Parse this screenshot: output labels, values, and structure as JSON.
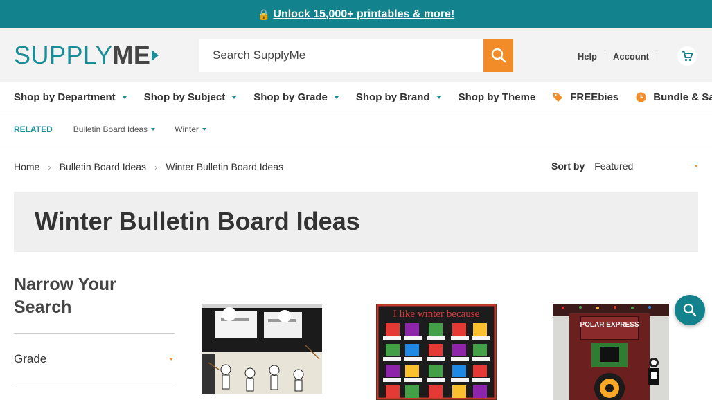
{
  "promo": {
    "text": "Unlock 15,000+ printables & more!"
  },
  "logo": {
    "part1": "SUPPLY",
    "part2": "ME"
  },
  "search": {
    "placeholder": "Search SupplyMe"
  },
  "header_links": {
    "help": "Help",
    "account": "Account"
  },
  "nav": {
    "items": [
      {
        "label": "Shop by Department"
      },
      {
        "label": "Shop by Subject"
      },
      {
        "label": "Shop by Grade"
      },
      {
        "label": "Shop by Brand"
      },
      {
        "label": "Shop by Theme"
      },
      {
        "label": "FREEbies"
      },
      {
        "label": "Bundle & Save!"
      }
    ]
  },
  "related": {
    "label": "RELATED",
    "items": [
      {
        "label": "Bulletin Board Ideas"
      },
      {
        "label": "Winter"
      }
    ]
  },
  "breadcrumb": {
    "items": [
      "Home",
      "Bulletin Board Ideas",
      "Winter Bulletin Board Ideas"
    ]
  },
  "sort": {
    "label": "Sort by",
    "value": "Featured"
  },
  "page": {
    "title": "Winter Bulletin Board Ideas"
  },
  "filters": {
    "title": "Narrow Your Search",
    "facets": [
      {
        "label": "Grade"
      }
    ]
  },
  "products": [
    {
      "image_text": ""
    },
    {
      "image_text": "I like winter because"
    },
    {
      "image_text": "POLAR EXPRESS"
    }
  ],
  "colors": {
    "accent": "#12838d",
    "orange": "#f28c28",
    "text": "#333333"
  }
}
